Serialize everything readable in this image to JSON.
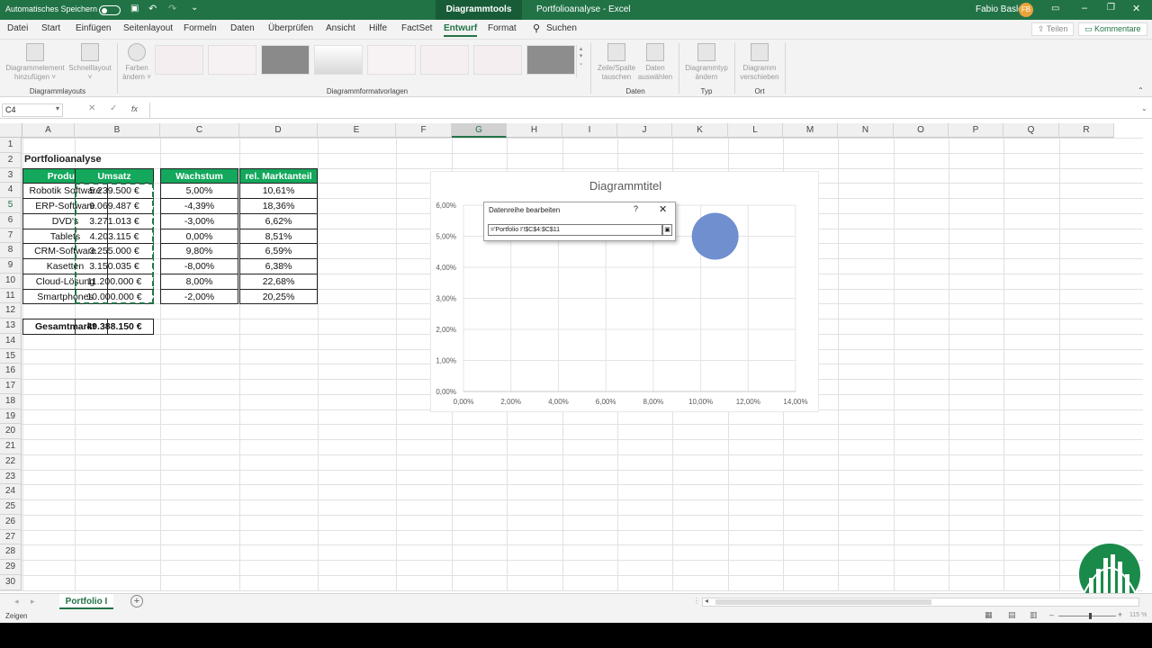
{
  "titlebar": {
    "autosave_label": "Automatisches Speichern",
    "context_tab": "Diagrammtools",
    "doc_title": "Portfolioanalyse - Excel",
    "user_name": "Fabio Basler",
    "user_initials": "FB"
  },
  "tabs": [
    "Datei",
    "Start",
    "Einfügen",
    "Seitenlayout",
    "Formeln",
    "Daten",
    "Überprüfen",
    "Ansicht",
    "Hilfe",
    "FactSet",
    "Entwurf",
    "Format"
  ],
  "active_tab": "Entwurf",
  "search_label": "Suchen",
  "share_label": "Teilen",
  "comments_label": "Kommentare",
  "ribbon": {
    "add_element": [
      "Diagrammelement",
      "hinzufügen ˅"
    ],
    "quick_layout": [
      "Schnelllayout",
      "˅"
    ],
    "change_colors": [
      "Farben",
      "ändern ˅"
    ],
    "group_layouts": "Diagrammlayouts",
    "group_styles": "Diagrammformatvorlagen",
    "switch_row_col": [
      "Zeile/Spalte",
      "tauschen"
    ],
    "select_data": [
      "Daten",
      "auswählen"
    ],
    "group_data": "Daten",
    "change_type": [
      "Diagrammtyp",
      "ändern"
    ],
    "group_type": "Typ",
    "move_chart": [
      "Diagramm",
      "verschieben"
    ],
    "group_location": "Ort"
  },
  "formula_bar": {
    "name_box": "C4",
    "fx": "fx",
    "content": ""
  },
  "columns": [
    "A",
    "B",
    "C",
    "D",
    "E",
    "F",
    "G",
    "H",
    "I",
    "J",
    "K",
    "L",
    "M",
    "N",
    "O",
    "P",
    "Q",
    "R"
  ],
  "selected_column": "G",
  "rows": [
    "1",
    "2",
    "3",
    "4",
    "5",
    "6",
    "7",
    "8",
    "9",
    "10",
    "11",
    "12",
    "13",
    "14",
    "15",
    "16",
    "17",
    "18",
    "19",
    "20",
    "21",
    "22",
    "23",
    "24",
    "25",
    "26",
    "27",
    "28",
    "29",
    "30"
  ],
  "sheet": {
    "title": "Portfolioanalyse",
    "headers": [
      "Produkt",
      "Umsatz",
      "Wachstum",
      "rel. Marktanteil"
    ],
    "table": [
      [
        "Robotik Software",
        "5.239.500 €",
        "5,00%",
        "10,61%"
      ],
      [
        "ERP-Software",
        "9.069.487 €",
        "-4,39%",
        "18,36%"
      ],
      [
        "DVD's",
        "3.271.013 €",
        "-3,00%",
        "6,62%"
      ],
      [
        "Tablets",
        "4.203.115 €",
        "0,00%",
        "8,51%"
      ],
      [
        "CRM-Software",
        "3.255.000 €",
        "9,80%",
        "6,59%"
      ],
      [
        "Kasetten",
        "3.150.035 €",
        "-8,00%",
        "6,38%"
      ],
      [
        "Cloud-Lösung",
        "11.200.000 €",
        "8,00%",
        "22,68%"
      ],
      [
        "Smartphones",
        "10.000.000 €",
        "-2,00%",
        "20,25%"
      ]
    ],
    "total_label": "Gesamtmarkt",
    "total_value": "49.388.150 €"
  },
  "chart_data": {
    "type": "scatter",
    "title": "Diagrammtitel",
    "x_ticks": [
      "0,00%",
      "2,00%",
      "4,00%",
      "6,00%",
      "8,00%",
      "10,00%",
      "12,00%",
      "14,00%"
    ],
    "y_ticks": [
      "0,00%",
      "1,00%",
      "2,00%",
      "3,00%",
      "4,00%",
      "5,00%",
      "6,00%"
    ],
    "xlim": [
      0,
      14
    ],
    "ylim": [
      0,
      6
    ],
    "points": [
      {
        "x": 10.61,
        "y": 5.0
      }
    ],
    "point_color": "#6f8fcf"
  },
  "dialog": {
    "title": "Datenreihe bearbeiten",
    "help": "?",
    "close": "✕",
    "input_value": "='Portfolio I'!$C$4:$C$11"
  },
  "sheet_tabs": [
    "Portfolio I"
  ],
  "status": {
    "mode": "Zeigen",
    "zoom": "115 %"
  },
  "colors": {
    "excel_green": "#217346",
    "table_header": "#13a85c"
  }
}
